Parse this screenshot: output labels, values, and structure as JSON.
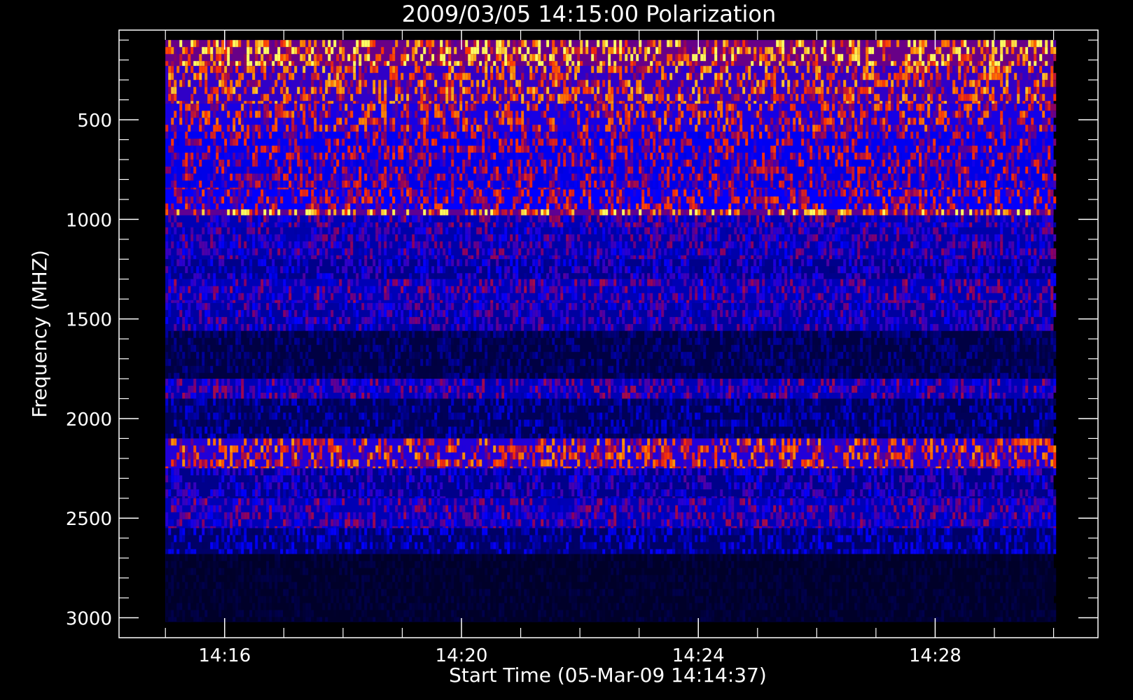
{
  "chart_data": {
    "type": "heatmap",
    "title": "2009/03/05 14:15:00 Polarization",
    "xlabel": "Start Time (05-Mar-09 14:14:37)",
    "ylabel": "Frequency (MHZ)",
    "x_ticks": [
      {
        "value": "14:16",
        "label": "14:16"
      },
      {
        "value": "14:20",
        "label": "14:20"
      },
      {
        "value": "14:24",
        "label": "14:24"
      },
      {
        "value": "14:28",
        "label": "14:28"
      }
    ],
    "y_ticks": [
      {
        "value": 500,
        "label": "500"
      },
      {
        "value": 1000,
        "label": "1000"
      },
      {
        "value": 1500,
        "label": "1500"
      },
      {
        "value": 2000,
        "label": "2000"
      },
      {
        "value": 2500,
        "label": "2500"
      },
      {
        "value": 3000,
        "label": "3000"
      }
    ],
    "xlim": [
      "14:14:13",
      "14:30:45"
    ],
    "ylim": [
      3100,
      50
    ],
    "y_axis_inverted": true,
    "data_time_range": [
      "14:15:00",
      "14:30:00"
    ],
    "data_freq_range": [
      100,
      3020
    ],
    "colormap": [
      "#00001a",
      "#0000ff",
      "#8a0060",
      "#ff3000",
      "#ff9000",
      "#ffff60"
    ],
    "bands": [
      {
        "f0": 100,
        "f1": 230,
        "level": 0.78
      },
      {
        "f0": 230,
        "f1": 420,
        "level": 0.6
      },
      {
        "f0": 420,
        "f1": 560,
        "level": 0.52
      },
      {
        "f0": 560,
        "f1": 700,
        "level": 0.42
      },
      {
        "f0": 700,
        "f1": 850,
        "level": 0.4
      },
      {
        "f0": 850,
        "f1": 950,
        "level": 0.45
      },
      {
        "f0": 950,
        "f1": 980,
        "level": 0.75
      },
      {
        "f0": 980,
        "f1": 1040,
        "level": 0.3
      },
      {
        "f0": 1040,
        "f1": 1200,
        "level": 0.28
      },
      {
        "f0": 1200,
        "f1": 1300,
        "level": 0.22
      },
      {
        "f0": 1300,
        "f1": 1420,
        "level": 0.3
      },
      {
        "f0": 1420,
        "f1": 1560,
        "level": 0.26
      },
      {
        "f0": 1560,
        "f1": 1800,
        "level": 0.08
      },
      {
        "f0": 1800,
        "f1": 1900,
        "level": 0.3
      },
      {
        "f0": 1900,
        "f1": 2100,
        "level": 0.12
      },
      {
        "f0": 2100,
        "f1": 2250,
        "level": 0.55
      },
      {
        "f0": 2250,
        "f1": 2400,
        "level": 0.22
      },
      {
        "f0": 2400,
        "f1": 2550,
        "level": 0.3
      },
      {
        "f0": 2550,
        "f1": 2680,
        "level": 0.15
      },
      {
        "f0": 2680,
        "f1": 3020,
        "level": 0.03
      }
    ]
  }
}
